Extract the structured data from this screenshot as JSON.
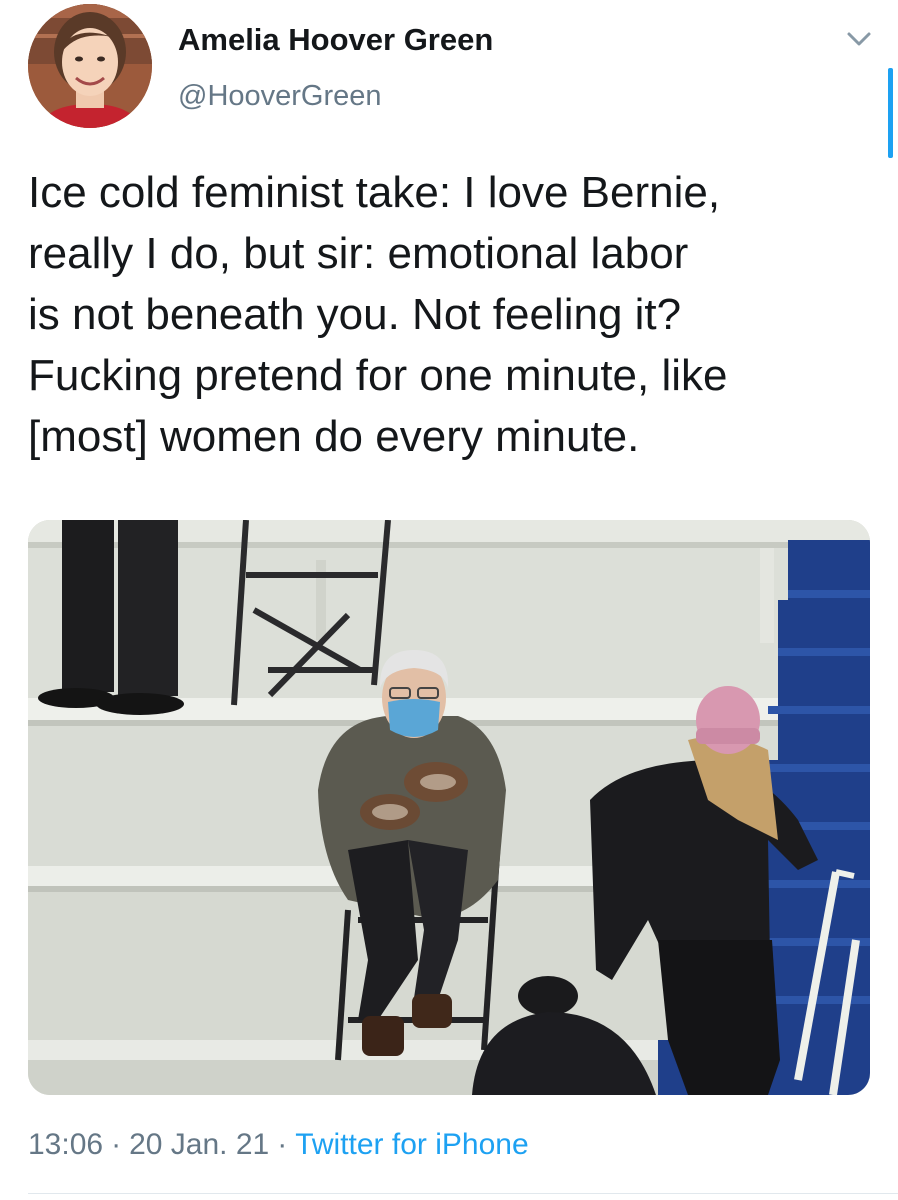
{
  "tweet": {
    "author": {
      "display_name": "Amelia Hoover Green",
      "handle": "@HooverGreen"
    },
    "text_lines": [
      "Ice cold feminist take: I love Bernie,",
      "really I do, but sir: emotional labor",
      "is not beneath you. Not feeling it?",
      "Fucking pretend for one minute, like",
      "[most] women do every minute."
    ],
    "meta": {
      "time": "13:06",
      "separator": "·",
      "date": "20 Jan. 21",
      "source": "Twitter for iPhone"
    },
    "icons": {
      "menu": "chevron-down-icon"
    },
    "colors": {
      "accent": "#1da1f2",
      "secondary_text": "#657786",
      "primary_text": "#14171a"
    }
  }
}
